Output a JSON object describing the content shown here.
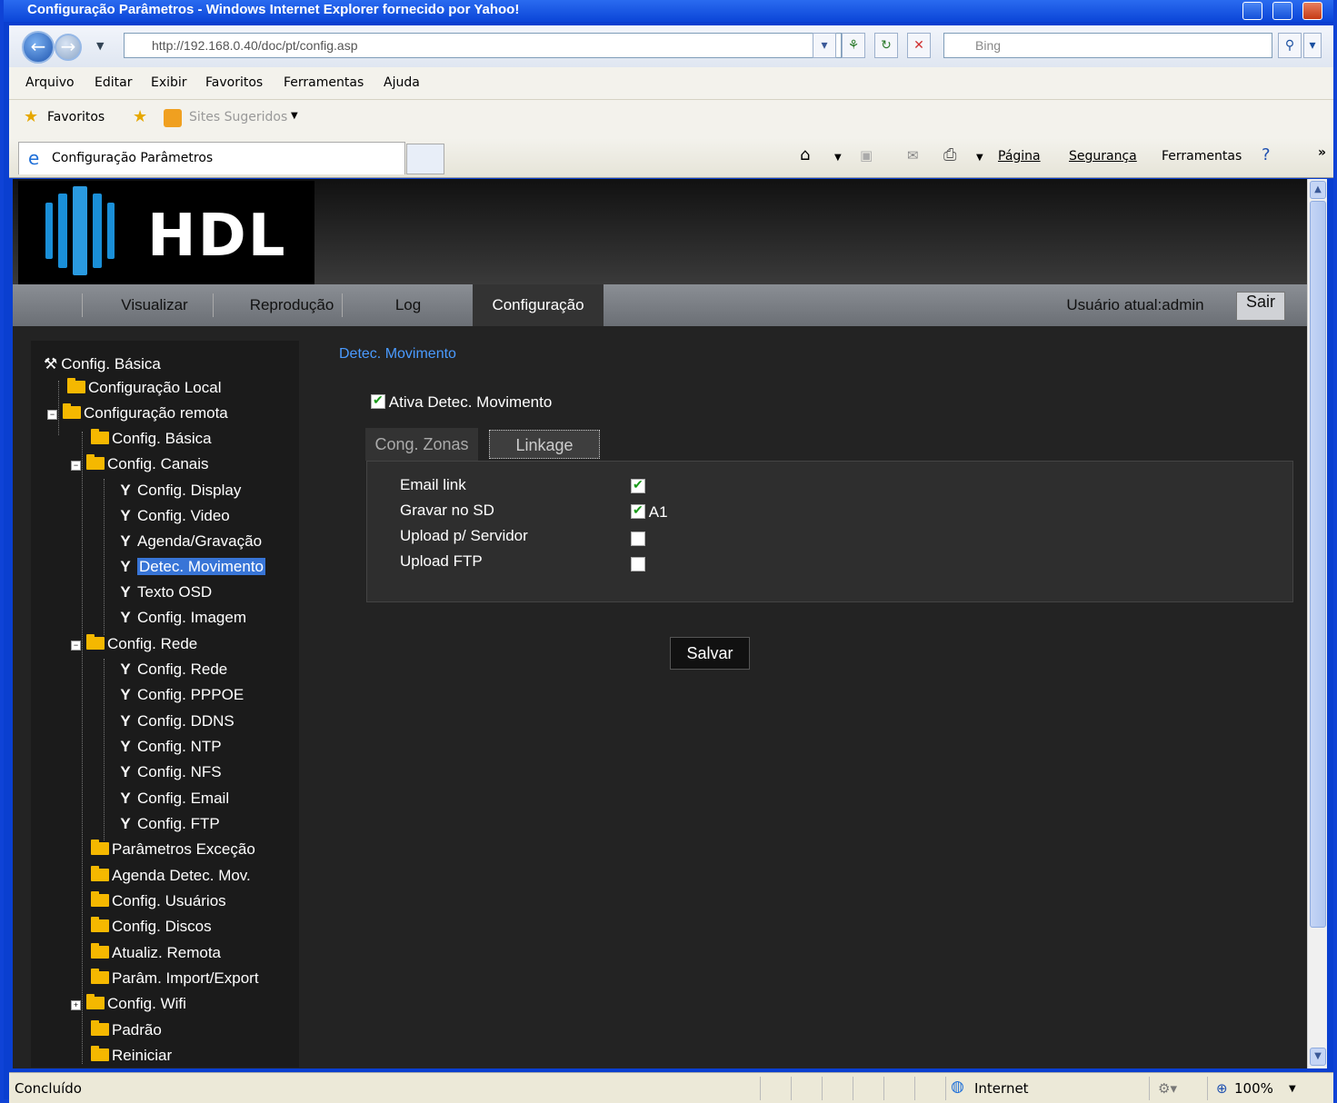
{
  "window": {
    "title": "Configuração Parâmetros - Windows Internet Explorer fornecido por Yahoo!"
  },
  "address": {
    "url": "http://192.168.0.40/doc/pt/config.asp",
    "search_placeholder": "Bing"
  },
  "menu": [
    "Arquivo",
    "Editar",
    "Exibir",
    "Favoritos",
    "Ferramentas",
    "Ajuda"
  ],
  "favorites": {
    "label": "Favoritos",
    "suggested": "Sites Sugeridos"
  },
  "browser_tab": {
    "title": "Configuração Parâmetros"
  },
  "commandbar": {
    "page": "Página",
    "security": "Segurança",
    "tools": "Ferramentas"
  },
  "app": {
    "logo": "HDL",
    "nav": [
      "Visualizar",
      "Reprodução",
      "Log",
      "Configuração"
    ],
    "user": "Usuário atual:admin",
    "logout": "Sair"
  },
  "tree": {
    "root": "Config. Básica",
    "local": "Configuração Local",
    "remote": "Configuração remota",
    "basic": "Config. Básica",
    "channels": "Config. Canais",
    "channel_items": [
      "Config. Display",
      "Config. Video",
      "Agenda/Gravação",
      "Detec. Movimento",
      "Texto OSD",
      "Config. Imagem"
    ],
    "network": "Config. Rede",
    "network_items": [
      "Config. Rede",
      "Config. PPPOE",
      "Config. DDNS",
      "Config. NTP",
      "Config. NFS",
      "Config. Email",
      "Config. FTP"
    ],
    "others": [
      "Parâmetros Exceção",
      "Agenda Detec. Mov.",
      "Config. Usuários",
      "Config. Discos",
      "Atualiz. Remota",
      "Parâm. Import/Export"
    ],
    "wifi": "Config. Wifi",
    "tail": [
      "Padrão",
      "Reiniciar"
    ]
  },
  "content": {
    "section_title": "Detec. Movimento",
    "enable_label": "Ativa Detec. Movimento",
    "tabs": [
      "Cong. Zonas",
      "Linkage"
    ],
    "linkage": [
      {
        "label": "Email link",
        "checked": true,
        "extra": ""
      },
      {
        "label": "Gravar no SD",
        "checked": true,
        "extra": "A1"
      },
      {
        "label": "Upload p/ Servidor",
        "checked": false,
        "extra": ""
      },
      {
        "label": "Upload FTP",
        "checked": false,
        "extra": ""
      }
    ],
    "save": "Salvar"
  },
  "statusbar": {
    "text": "Concluído",
    "zone": "Internet",
    "zoom": "100%"
  }
}
